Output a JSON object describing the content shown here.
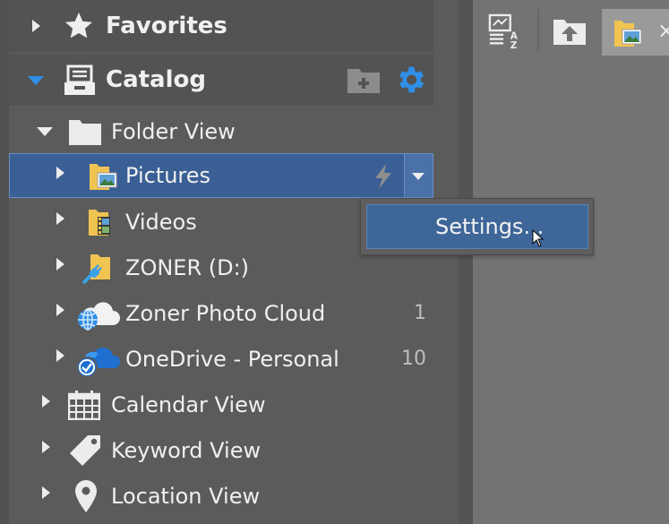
{
  "sidebar": {
    "favorites": {
      "label": "Favorites",
      "icon": "star-icon"
    },
    "catalog": {
      "label": "Catalog",
      "icon": "catalog-drawer-icon",
      "actions": [
        {
          "name": "add-folder-button",
          "icon": "add-folder-icon"
        },
        {
          "name": "settings-button",
          "icon": "gear-icon",
          "color": "#2f8ee6"
        }
      ]
    },
    "folder_view": {
      "label": "Folder View",
      "items": [
        {
          "label": "Pictures",
          "count": "",
          "icon": "pictures-folder-icon"
        },
        {
          "label": "Videos",
          "count": "",
          "icon": "videos-folder-icon"
        },
        {
          "label": "ZONER (D:)",
          "count": "",
          "icon": "network-drive-icon"
        },
        {
          "label": "Zoner Photo Cloud",
          "count": "1",
          "icon": "cloud-icon"
        },
        {
          "label": "OneDrive - Personal",
          "count": "10",
          "icon": "onedrive-icon"
        }
      ]
    },
    "views": [
      {
        "label": "Calendar View",
        "icon": "calendar-icon"
      },
      {
        "label": "Keyword View",
        "icon": "tag-icon"
      },
      {
        "label": "Location View",
        "icon": "location-pin-icon"
      }
    ]
  },
  "popup": {
    "settings_label": "Settings..."
  },
  "toolbar": {
    "buttons": [
      {
        "name": "sort-az-button",
        "icon": "sort-az-icon"
      },
      {
        "name": "up-folder-button",
        "icon": "up-folder-icon"
      }
    ],
    "tab_icon": "pictures-folder-icon",
    "tab_close": "×"
  },
  "colors": {
    "selection": "#3a5f95",
    "accent": "#2f8ee6",
    "catalog_arrow": "#2f8ee6"
  }
}
